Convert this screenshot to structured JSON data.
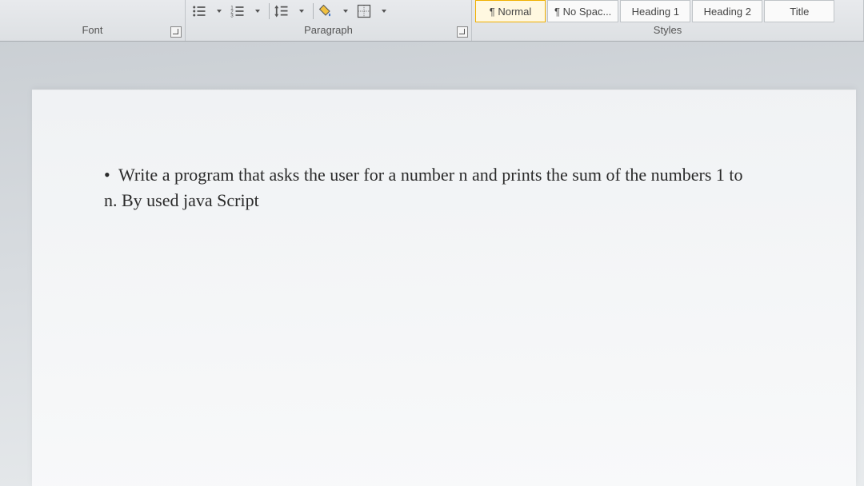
{
  "ribbon": {
    "font": {
      "label": "Font"
    },
    "paragraph": {
      "label": "Paragraph"
    },
    "styles": {
      "label": "Styles",
      "items": [
        {
          "label": "¶ Normal",
          "selected": true
        },
        {
          "label": "¶ No Spac...",
          "selected": false
        },
        {
          "label": "Heading 1",
          "selected": false
        },
        {
          "label": "Heading 2",
          "selected": false
        },
        {
          "label": "Title",
          "selected": false
        }
      ]
    }
  },
  "document": {
    "bullet_glyph": "•",
    "bullet_text": "Write a program that asks the user for a number n and prints the sum of the numbers 1 to n. By used java Script"
  }
}
